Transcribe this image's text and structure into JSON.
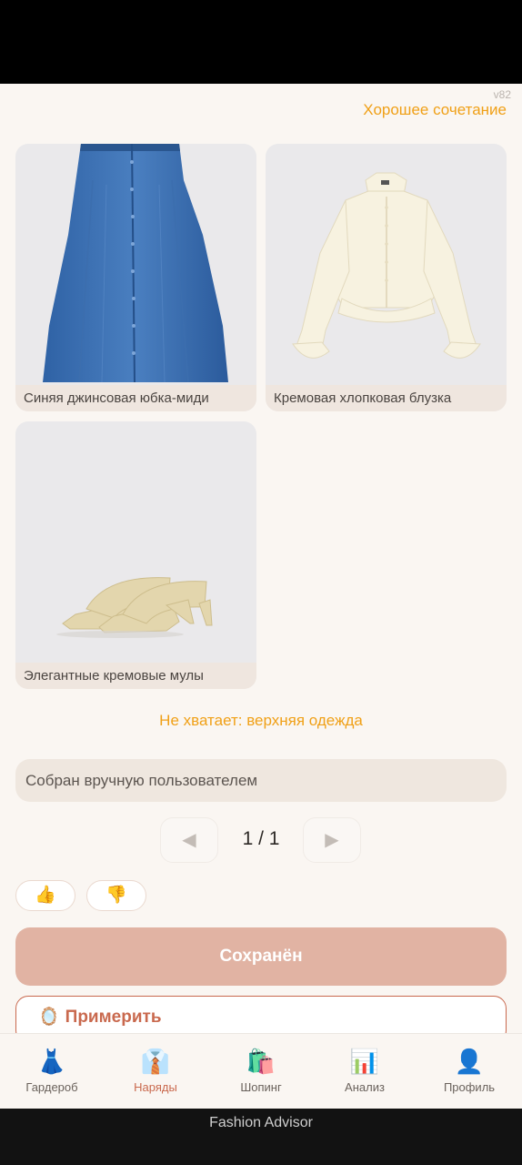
{
  "header": {
    "version": "v82",
    "match_label": "Хорошее сочетание"
  },
  "items": [
    {
      "name": "Синяя джинсовая юбка-миди",
      "icon": "denim-skirt-image"
    },
    {
      "name": "Кремовая хлопковая блузка",
      "icon": "cream-blouse-image"
    },
    {
      "name": "Элегантные кремовые мулы",
      "icon": "cream-mules-image"
    }
  ],
  "missing_label": "Не хватает: верхняя одежда",
  "note_text": "Собран вручную пользователем",
  "pager": {
    "prev": "◀",
    "next": "▶",
    "indicator": "1 / 1"
  },
  "feedback": {
    "like": "👍",
    "dislike": "👎"
  },
  "saved_label": "Сохранён",
  "tryon": {
    "icon": "🪞",
    "label": "Примерить"
  },
  "tabs": [
    {
      "icon": "👗",
      "label": "Гардероб"
    },
    {
      "icon": "👔",
      "label": "Наряды"
    },
    {
      "icon": "🛍️",
      "label": "Шопинг"
    },
    {
      "icon": "📊",
      "label": "Анализ"
    },
    {
      "icon": "👤",
      "label": "Профиль"
    }
  ],
  "app_name": "Fashion Advisor",
  "colors": {
    "accent": "#f0a017",
    "primary": "#c9694e",
    "saved_bg": "#e1b3a3",
    "background": "#faf6f2"
  }
}
